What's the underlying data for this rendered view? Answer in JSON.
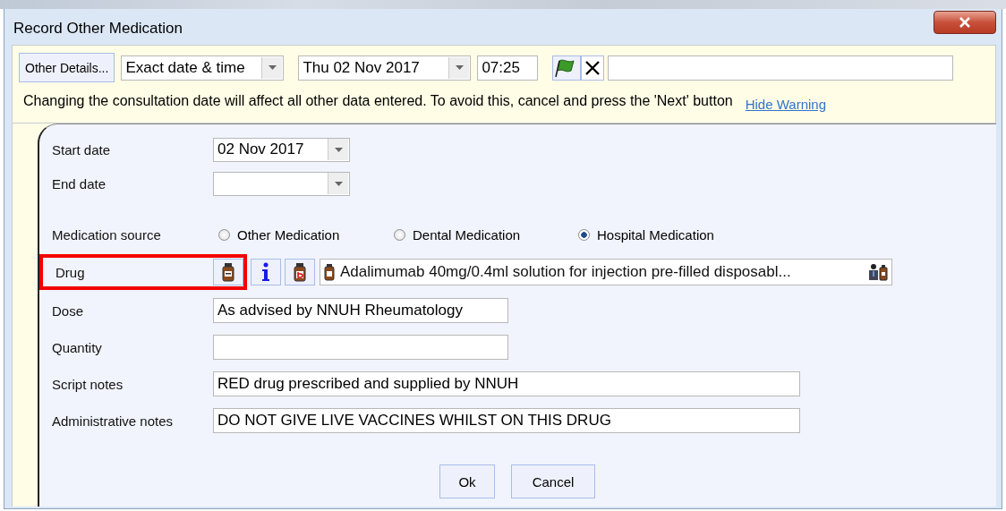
{
  "window": {
    "title": "Record Other Medication"
  },
  "toolbar": {
    "details_button": "Other Details...",
    "date_mode": "Exact date & time",
    "date": "Thu 02 Nov 2017",
    "time": "07:25"
  },
  "warning": {
    "text": "Changing the consultation date will affect all other data entered. To avoid this, cancel and press the 'Next' button",
    "link": "Hide Warning"
  },
  "form": {
    "start_date": {
      "label": "Start date",
      "value": "02 Nov 2017"
    },
    "end_date": {
      "label": "End date"
    },
    "source": {
      "label": "Medication source",
      "options": [
        {
          "label": "Other Medication",
          "selected": false
        },
        {
          "label": "Dental Medication",
          "selected": false
        },
        {
          "label": "Hospital Medication",
          "selected": true
        }
      ]
    },
    "drug": {
      "label": "Drug",
      "value": "Adalimumab 40mg/0.4ml solution for injection pre-filled disposabl...",
      "highlighted": true
    },
    "fields": [
      {
        "label": "Dose",
        "value": "As advised by NNUH Rheumatology"
      },
      {
        "label": "Quantity"
      },
      {
        "label": "Script notes",
        "value": "RED drug prescribed and supplied by NNUH"
      },
      {
        "label": "Administrative notes",
        "value": "DO NOT GIVE LIVE VACCINES WHILST ON THIS DRUG"
      }
    ]
  },
  "buttons": [
    "Ok",
    "Cancel"
  ]
}
